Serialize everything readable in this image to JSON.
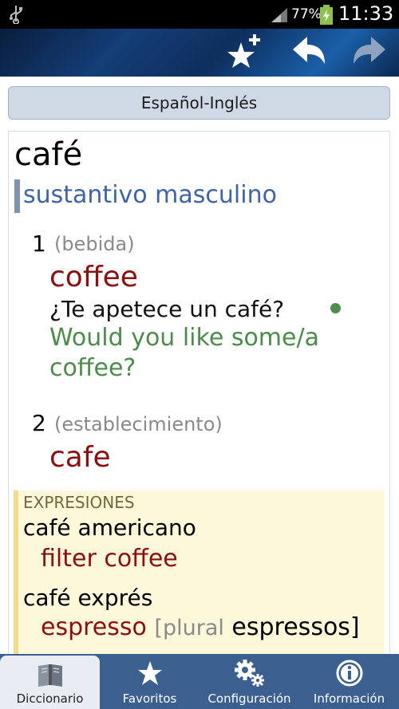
{
  "status": {
    "battery_pct": "77%",
    "time": "11:33"
  },
  "toolbar": {
    "add_favorite_icon": "star-plus-icon",
    "back_icon": "back-arrow-icon",
    "forward_icon": "forward-arrow-icon"
  },
  "language": {
    "label": "Español-Inglés"
  },
  "entry": {
    "headword": "café",
    "pos": "sustantivo masculino",
    "senses": [
      {
        "num": "1",
        "gloss": "(bebida)",
        "translation": "coffee",
        "example": "¿Te apetece un café?",
        "example_translation": "Would you like some/a coffee?"
      },
      {
        "num": "2",
        "gloss": "(establecimiento)",
        "translation": "cafe"
      }
    ],
    "expressions": {
      "header": "EXPRESIONES",
      "items": [
        {
          "word": "café americano",
          "translation": "filter coffee"
        },
        {
          "word": "café exprés",
          "translation": "espresso",
          "plural_label": "[plural",
          "plural_word": "espressos]"
        }
      ]
    }
  },
  "nav": {
    "items": [
      {
        "label": "Diccionario",
        "icon": "book-icon",
        "active": true
      },
      {
        "label": "Favoritos",
        "icon": "star-icon",
        "active": false
      },
      {
        "label": "Configuración",
        "icon": "gears-icon",
        "active": false
      },
      {
        "label": "Información",
        "icon": "info-icon",
        "active": false
      }
    ]
  },
  "colors": {
    "action_bar": "#143e77",
    "nav_bar": "#3b5f8e",
    "translation": "#8b0f0f",
    "example_translation": "#4c8c4b",
    "pos": "#3f64a4",
    "expression_bg": "#fcf8d9"
  }
}
